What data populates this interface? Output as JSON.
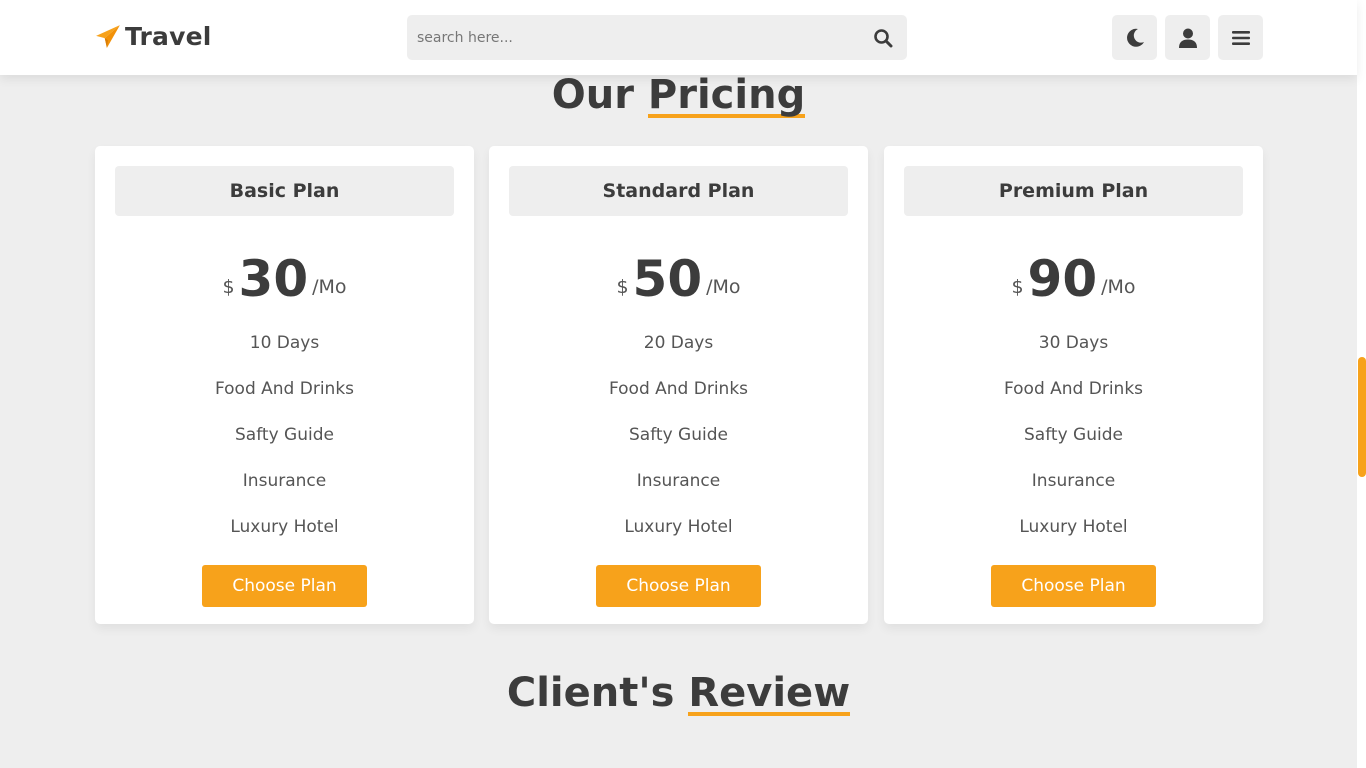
{
  "header": {
    "logo_text": "Travel",
    "logo_icon": "paper-plane-icon",
    "search_placeholder": "search here...",
    "search_icon": "search-icon",
    "icons": [
      "moon-icon",
      "user-icon",
      "menu-icon"
    ]
  },
  "pricing": {
    "heading_prefix": "Our",
    "heading_accent": "Pricing",
    "plans": [
      {
        "title": "Basic Plan",
        "currency": "$",
        "amount": "30",
        "period": "/Mo",
        "features": [
          "10 Days",
          "Food And Drinks",
          "Safty Guide",
          "Insurance",
          "Luxury Hotel"
        ],
        "button_label": "Choose Plan"
      },
      {
        "title": "Standard Plan",
        "currency": "$",
        "amount": "50",
        "period": "/Mo",
        "features": [
          "20 Days",
          "Food And Drinks",
          "Safty Guide",
          "Insurance",
          "Luxury Hotel"
        ],
        "button_label": "Choose Plan"
      },
      {
        "title": "Premium Plan",
        "currency": "$",
        "amount": "90",
        "period": "/Mo",
        "features": [
          "30 Days",
          "Food And Drinks",
          "Safty Guide",
          "Insurance",
          "Luxury Hotel"
        ],
        "button_label": "Choose Plan"
      }
    ]
  },
  "review": {
    "heading_prefix": "Client's",
    "heading_accent": "Review"
  },
  "colors": {
    "accent": "#f7a21b",
    "text": "#3c3c3c",
    "background": "#eeeeee"
  }
}
